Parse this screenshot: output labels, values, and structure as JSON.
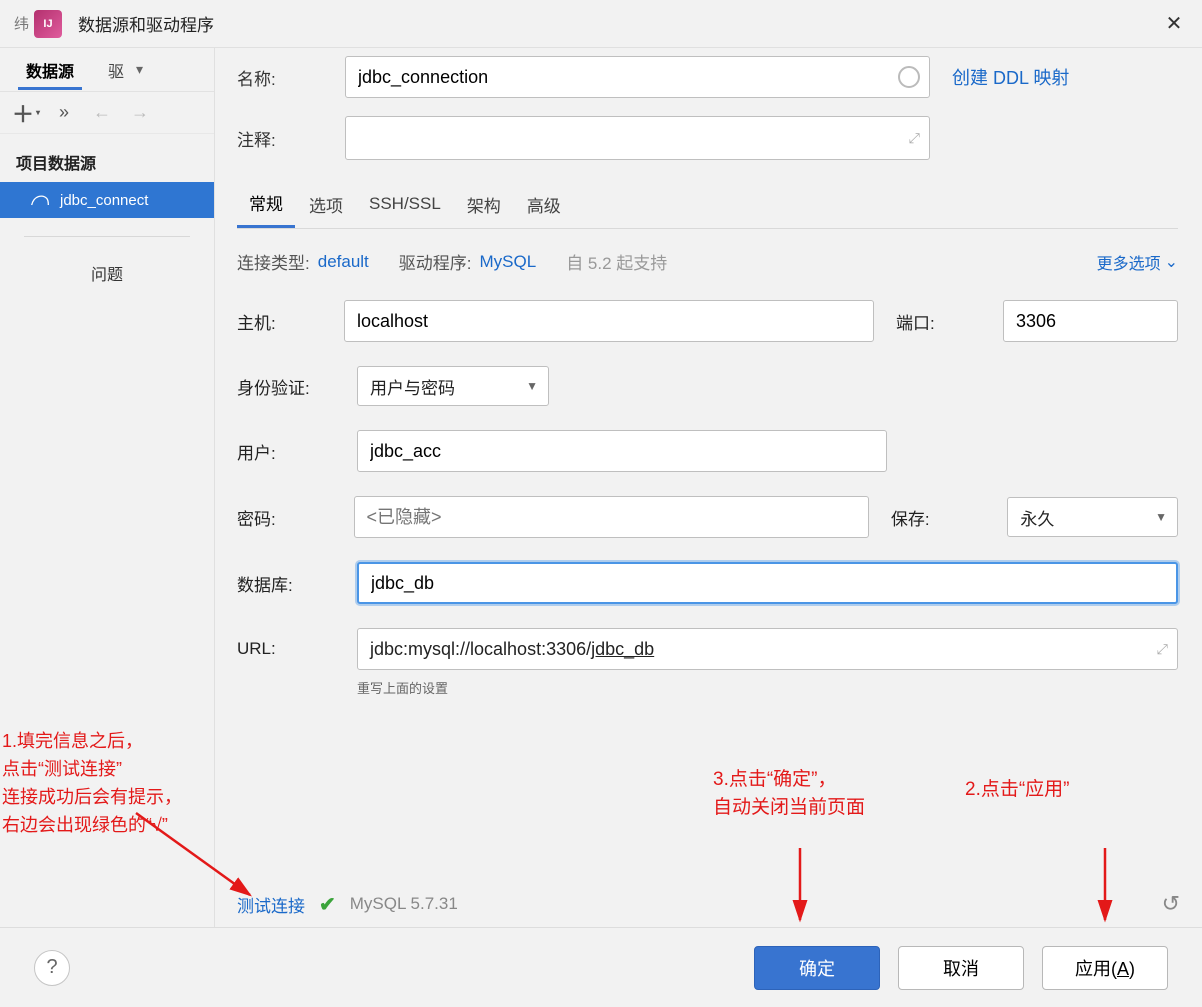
{
  "titlebar": {
    "title": "数据源和驱动程序"
  },
  "sidebar": {
    "tabs": {
      "sources": "数据源",
      "drivers_short": "驱"
    },
    "section_title": "项目数据源",
    "item_label": "jdbc_connect",
    "problems": "问题"
  },
  "main": {
    "name_label": "名称:",
    "name_value": "jdbc_connection",
    "ddl_link": "创建 DDL 映射",
    "comment_label": "注释:",
    "comment_value": "",
    "tabs": {
      "general": "常规",
      "options": "选项",
      "ssh": "SSH/SSL",
      "schema": "架构",
      "advanced": "高级"
    },
    "conn_type_label": "连接类型:",
    "conn_type_value": "default",
    "driver_label": "驱动程序:",
    "driver_value": "MySQL",
    "driver_since": "自 5.2 起支持",
    "more_options": "更多选项",
    "host_label": "主机:",
    "host_value": "localhost",
    "port_label": "端口:",
    "port_value": "3306",
    "auth_label": "身份验证:",
    "auth_value": "用户与密码",
    "user_label": "用户:",
    "user_value": "jdbc_acc",
    "pwd_label": "密码:",
    "pwd_placeholder": "<已隐藏>",
    "save_label": "保存:",
    "save_value": "永久",
    "db_label": "数据库:",
    "db_value": "jdbc_db",
    "url_label": "URL:",
    "url_prefix": "jdbc:mysql://localhost:3306/",
    "url_db": "jdbc_db",
    "url_hint": "重写上面的设置",
    "test_link": "测试连接",
    "mysql_version": "MySQL 5.7.31"
  },
  "footer": {
    "ok": "确定",
    "cancel": "取消",
    "apply_prefix": "应用(",
    "apply_key": "A",
    "apply_suffix": ")"
  },
  "annotations": {
    "note1": "1.填完信息之后，\n点击“测试连接”\n连接成功后会有提示，\n右边会出现绿色的“√”",
    "note3_line1": "3.点击“确定”，",
    "note3_line2": "自动关闭当前页面",
    "note2": "2.点击“应用”"
  }
}
